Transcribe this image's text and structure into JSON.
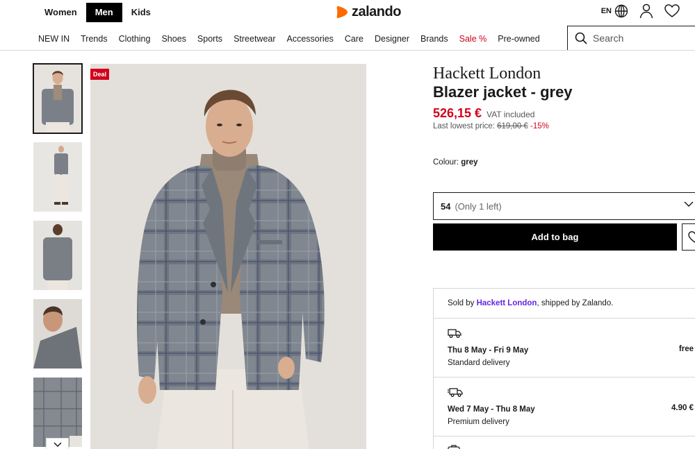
{
  "header": {
    "gender_tabs": [
      "Women",
      "Men",
      "Kids"
    ],
    "active_gender": "Men",
    "logo_text": "zalando",
    "language": "EN"
  },
  "nav": {
    "items": [
      "NEW IN",
      "Trends",
      "Clothing",
      "Shoes",
      "Sports",
      "Streetwear",
      "Accessories",
      "Care",
      "Designer",
      "Brands",
      "Sale %",
      "Pre-owned"
    ],
    "search_placeholder": "Search"
  },
  "product": {
    "badge": "Deal",
    "brand": "Hackett London",
    "name": "Blazer jacket - grey",
    "price": "526,15 €",
    "vat_note": "VAT included",
    "lowest_label": "Last lowest price:",
    "old_price": "619,00 €",
    "discount": "-15%",
    "colour_label": "Colour:",
    "colour_value": "grey",
    "size_value": "54",
    "size_stock": "(Only 1 left)",
    "add_to_bag": "Add to bag"
  },
  "delivery": {
    "sold_prefix": "Sold by",
    "seller": "Hackett London",
    "sold_suffix": ", shipped by Zalando.",
    "options": [
      {
        "dates": "Thu 8 May - Fri 9 May",
        "type": "Standard delivery",
        "cost": "free"
      },
      {
        "dates": "Wed 7 May - Thu 8 May",
        "type": "Premium delivery",
        "cost": "4.90 €"
      }
    ]
  },
  "colors": {
    "accent_red": "#d0021b",
    "logo_orange": "#ff6900",
    "seller_link": "#6328e0"
  }
}
